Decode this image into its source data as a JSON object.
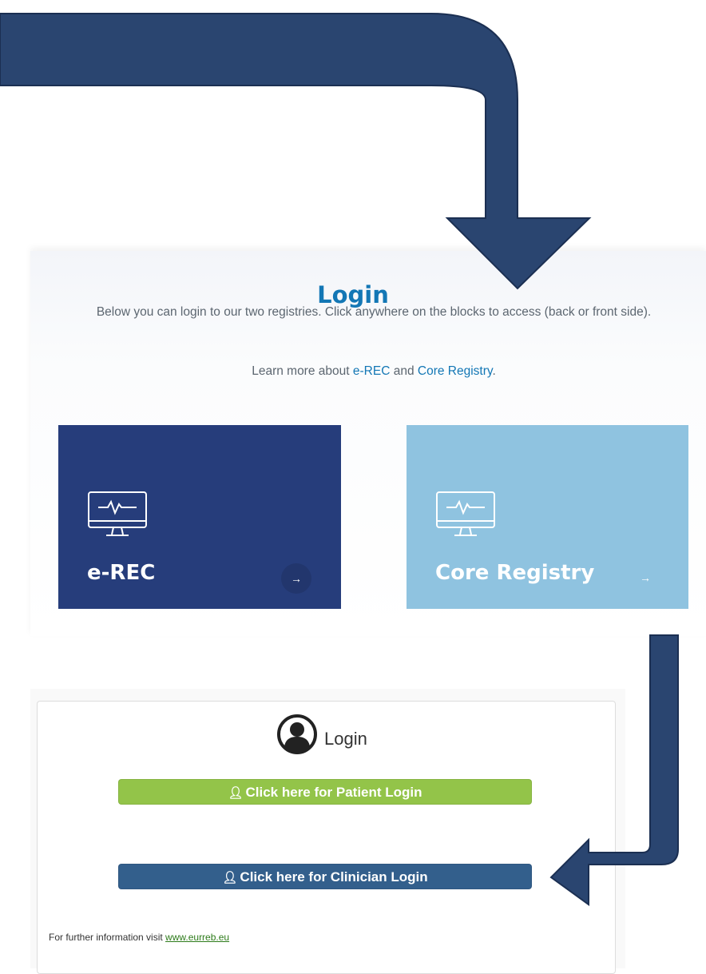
{
  "hero": {
    "title": "Login",
    "intro": "Below you can login to our two registries. Click anywhere on the blocks to access (back or front side).",
    "learn_prefix": "Learn more about ",
    "learn_link1": "e-REC",
    "learn_mid": " and ",
    "learn_link2": "Core Registry",
    "learn_suffix": "."
  },
  "cards": {
    "erec": {
      "title": "e-REC",
      "arrow": "→",
      "icon": "monitor-heartbeat-icon",
      "color": "#263d7b"
    },
    "core": {
      "title": "Core Registry",
      "arrow": "→",
      "icon": "monitor-heartbeat-icon",
      "color": "#8fc3e0"
    }
  },
  "login_box": {
    "title": "Login",
    "icon": "user-circle-icon",
    "patient_button": "Click here for Patient Login",
    "patient_icon": "user-icon",
    "patient_color": "#93c449",
    "clinician_button": "Click here for Clinician Login",
    "clinician_icon": "user-md-icon",
    "clinician_color": "#335f8c",
    "info_prefix": "For further information visit ",
    "info_link": "www.eurreb.eu"
  },
  "annotations": {
    "arrow_color": "#2a4570",
    "arrows": [
      "curved-down-arrow",
      "hook-left-arrow"
    ]
  }
}
